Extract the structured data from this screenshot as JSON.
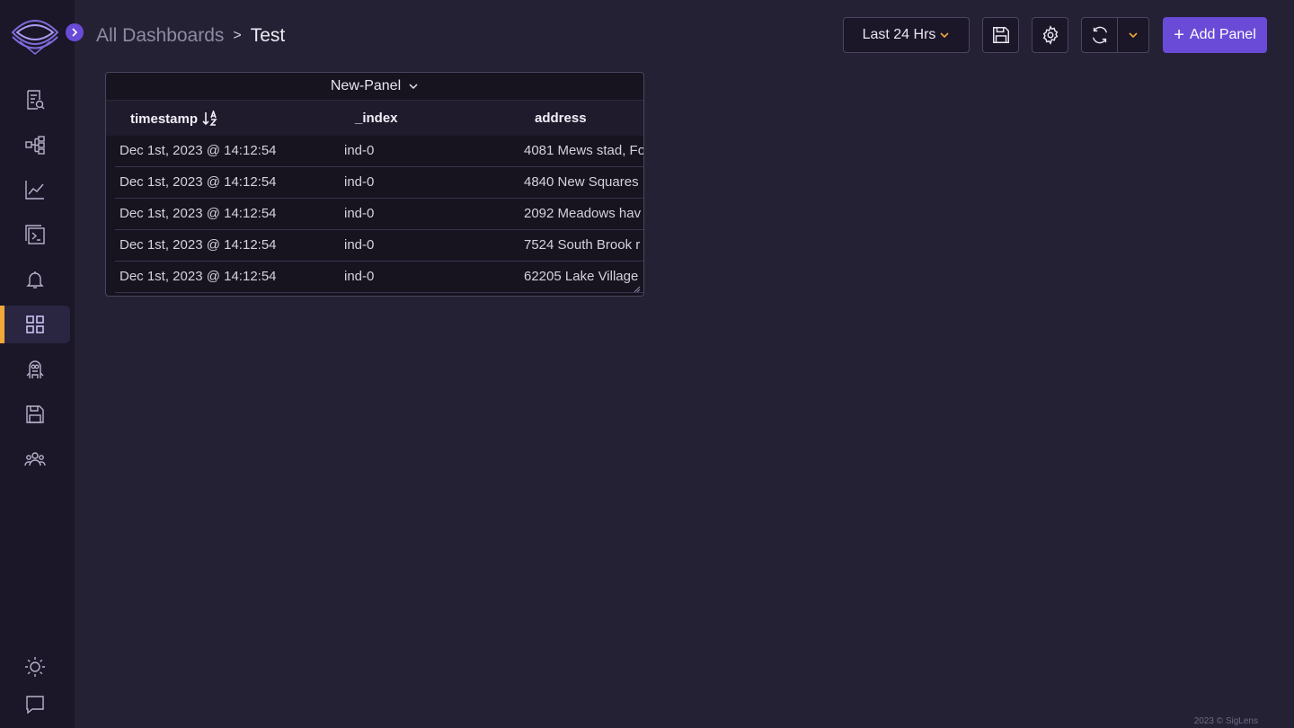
{
  "sidebar": {
    "logo": "siglens-eye-logo",
    "expand_icon": "chevron-right-icon",
    "items": [
      {
        "icon": "log-search-icon",
        "label": "Logs"
      },
      {
        "icon": "service-graph-icon",
        "label": "Tracing"
      },
      {
        "icon": "line-chart-icon",
        "label": "Metrics"
      },
      {
        "icon": "terminal-icon",
        "label": "Live Tail"
      },
      {
        "icon": "bell-icon",
        "label": "Alerts"
      },
      {
        "icon": "dashboard-grid-icon",
        "label": "Dashboards",
        "active": true
      },
      {
        "icon": "robot-icon",
        "label": "Minion"
      },
      {
        "icon": "floppy-disk-icon",
        "label": "Saved Queries"
      },
      {
        "icon": "users-icon",
        "label": "Team"
      }
    ],
    "bottom": [
      {
        "icon": "sun-icon"
      },
      {
        "icon": "chat-icon"
      }
    ]
  },
  "header": {
    "breadcrumb_root": "All Dashboards",
    "breadcrumb_sep": ">",
    "breadcrumb_current": "Test",
    "time_range": "Last 24 Hrs",
    "add_panel_label": "Add Panel"
  },
  "panel": {
    "title": "New-Panel",
    "columns": [
      "timestamp",
      "_index",
      "address"
    ],
    "rows": [
      {
        "timestamp": "Dec 1st, 2023 @ 14:12:54",
        "index": "ind-0",
        "address": "4081 Mews stad, Fo"
      },
      {
        "timestamp": "Dec 1st, 2023 @ 14:12:54",
        "index": "ind-0",
        "address": "4840 New Squares"
      },
      {
        "timestamp": "Dec 1st, 2023 @ 14:12:54",
        "index": "ind-0",
        "address": "2092 Meadows hav"
      },
      {
        "timestamp": "Dec 1st, 2023 @ 14:12:54",
        "index": "ind-0",
        "address": "7524 South Brook r"
      },
      {
        "timestamp": "Dec 1st, 2023 @ 14:12:54",
        "index": "ind-0",
        "address": "62205 Lake Village"
      }
    ]
  },
  "footer": "2023 © SigLens",
  "colors": {
    "background": "#252135",
    "sidebar": "#1b1628",
    "accent": "#6a4bd8",
    "active_marker": "#f2a93b",
    "chevron": "#f2a93b"
  }
}
